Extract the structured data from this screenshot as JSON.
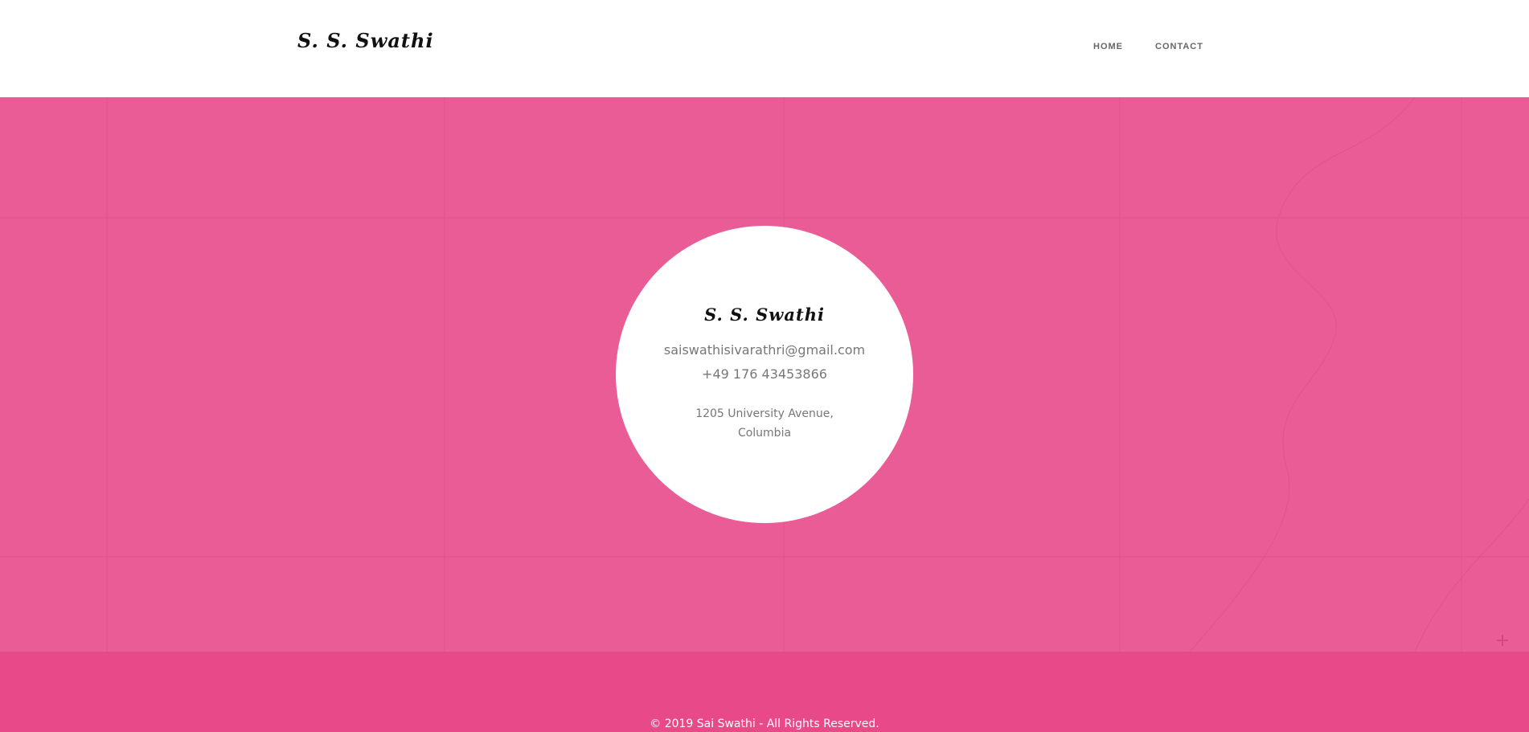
{
  "header": {
    "logo_text": "S. S. Swathi",
    "nav": [
      {
        "label": "HOME"
      },
      {
        "label": "CONTACT"
      }
    ]
  },
  "contact": {
    "name": "S. S. Swathi",
    "email": "saiswathisivarathri@gmail.com",
    "phone": "+49 176 43453866",
    "address_line1": "1205 University Avenue,",
    "address_line2": "Columbia"
  },
  "footer": {
    "copyright": "© 2019 Sai Swathi - All Rights Reserved."
  },
  "colors": {
    "map_background": "#ea5c95",
    "footer_background": "#e84a87",
    "header_background": "#ffffff"
  }
}
